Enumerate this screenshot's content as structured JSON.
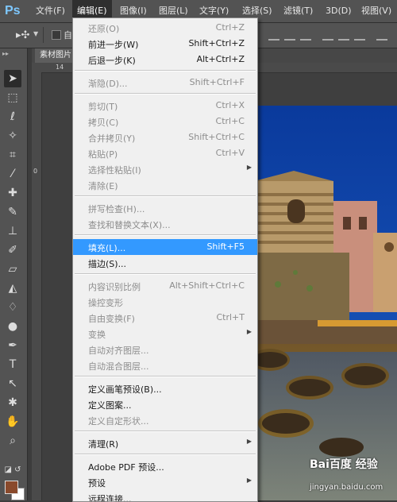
{
  "app": {
    "logo": "Ps",
    "accent": "#3399ff"
  },
  "menubar": {
    "file": "文件(F)",
    "edit": "编辑(E)",
    "image": "图像(I)",
    "layer": "图层(L)",
    "type": "文字(Y)",
    "select": "选择(S)",
    "filter": "滤镜(T)",
    "threed": "3D(D)",
    "view": "视图(V)"
  },
  "options": {
    "auto_select_label": "自"
  },
  "document": {
    "tab_label": "素材图片"
  },
  "ruler": {
    "top_mark": "14",
    "left_mark": "0"
  },
  "edit_menu": {
    "undo": {
      "label": "还原(O)",
      "shortcut": "Ctrl+Z"
    },
    "step_forward": {
      "label": "前进一步(W)",
      "shortcut": "Shift+Ctrl+Z"
    },
    "step_backward": {
      "label": "后退一步(K)",
      "shortcut": "Alt+Ctrl+Z"
    },
    "fade": {
      "label": "渐隐(D)...",
      "shortcut": "Shift+Ctrl+F"
    },
    "cut": {
      "label": "剪切(T)",
      "shortcut": "Ctrl+X"
    },
    "copy": {
      "label": "拷贝(C)",
      "shortcut": "Ctrl+C"
    },
    "copy_merged": {
      "label": "合并拷贝(Y)",
      "shortcut": "Shift+Ctrl+C"
    },
    "paste": {
      "label": "粘贴(P)",
      "shortcut": "Ctrl+V"
    },
    "paste_special": {
      "label": "选择性粘贴(I)"
    },
    "clear": {
      "label": "清除(E)"
    },
    "check_spelling": {
      "label": "拼写检查(H)..."
    },
    "find_replace": {
      "label": "查找和替换文本(X)..."
    },
    "fill": {
      "label": "填充(L)...",
      "shortcut": "Shift+F5"
    },
    "stroke": {
      "label": "描边(S)..."
    },
    "content_aware_scale": {
      "label": "内容识别比例",
      "shortcut": "Alt+Shift+Ctrl+C"
    },
    "puppet_warp": {
      "label": "操控变形"
    },
    "free_transform": {
      "label": "自由变换(F)",
      "shortcut": "Ctrl+T"
    },
    "transform": {
      "label": "变换"
    },
    "auto_align": {
      "label": "自动对齐图层..."
    },
    "auto_blend": {
      "label": "自动混合图层..."
    },
    "define_brush": {
      "label": "定义画笔预设(B)..."
    },
    "define_pattern": {
      "label": "定义图案..."
    },
    "define_shape": {
      "label": "定义自定形状..."
    },
    "purge": {
      "label": "清理(R)"
    },
    "pdf_presets": {
      "label": "Adobe PDF 预设..."
    },
    "presets": {
      "label": "预设"
    },
    "remote_connections": {
      "label": "远程连接..."
    }
  },
  "watermark": {
    "logo": "Bai百度 经验",
    "url": "jingyan.baidu.com"
  }
}
